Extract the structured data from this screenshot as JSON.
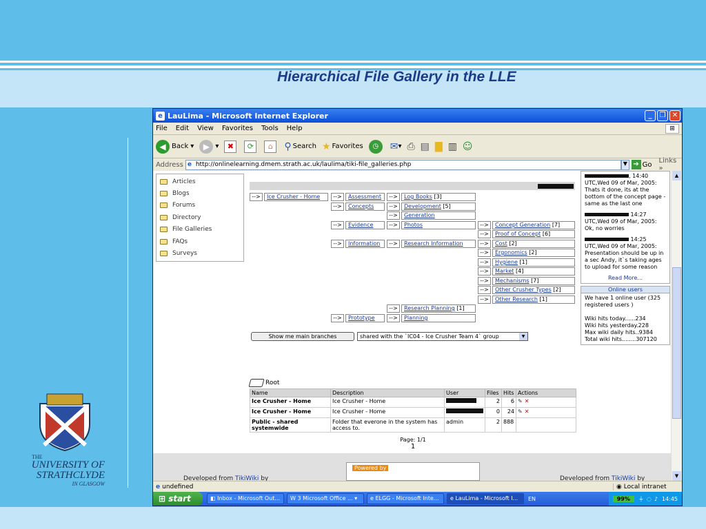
{
  "slide": {
    "title": "Hierarchical File Gallery in the LLE",
    "logo": {
      "the": "THE",
      "line1": "UNIVERSITY OF",
      "line2": "STRATHCLYDE",
      "line3": "IN GLASGOW"
    }
  },
  "window": {
    "title": "LauLima - Microsoft Internet Explorer",
    "menu": [
      "File",
      "Edit",
      "View",
      "Favorites",
      "Tools",
      "Help"
    ],
    "toolbar": {
      "back": "Back",
      "search": "Search",
      "favorites": "Favorites"
    },
    "address": {
      "label": "Address",
      "url": "http://onlinelearning.dmem.strath.ac.uk/laulima/tiki-file_galleries.php",
      "go": "Go",
      "links": "Links"
    }
  },
  "leftnav": [
    "Articles",
    "Blogs",
    "Forums",
    "Directory",
    "File Galleries",
    "FAQs",
    "Surveys"
  ],
  "tree": {
    "arrow": "-->",
    "root": "Ice Crusher - Home",
    "level2": [
      {
        "name": "Assessment"
      },
      {
        "name": "Concepts"
      },
      {
        "name": "Evidence"
      },
      {
        "name": "Information"
      },
      {
        "name": "Prototype"
      }
    ],
    "level3": [
      {
        "name": "Log Books",
        "count": "[3]"
      },
      {
        "name": "Development",
        "count": "[5]"
      },
      {
        "name": "Generation",
        "count": ""
      },
      {
        "name": "Photos",
        "count": ""
      },
      {
        "name": "Research Information",
        "count": ""
      },
      {
        "name": "Research Planning",
        "count": "[1]"
      },
      {
        "name": "Planning",
        "count": ""
      }
    ],
    "level4": [
      {
        "name": "Concept Generation",
        "count": "[7]"
      },
      {
        "name": "Proof of Concept",
        "count": "[6]"
      },
      {
        "name": "Cost",
        "count": "[2]"
      },
      {
        "name": "Ergonomics",
        "count": "[2]"
      },
      {
        "name": "Hygiene",
        "count": "[1]"
      },
      {
        "name": "Market",
        "count": "[4]"
      },
      {
        "name": "Mechanisms",
        "count": "[7]"
      },
      {
        "name": "Other Crusher Types",
        "count": "[2]"
      },
      {
        "name": "Other Research",
        "count": "[1]"
      }
    ]
  },
  "controls": {
    "show_button": "Show me main branches",
    "group_select": "shared with the `IC04 - Ice Crusher Team 4` group"
  },
  "gallery": {
    "root_label": "Root",
    "columns": [
      "Name",
      "Description",
      "User",
      "Files",
      "Hits",
      "Actions"
    ],
    "rows": [
      {
        "name": "Ice Crusher - Home",
        "description": "Ice Crusher - Home",
        "user": "",
        "files": "2",
        "hits": "6"
      },
      {
        "name": "Ice Crusher - Home",
        "description": "Ice Crusher - Home",
        "user": "",
        "files": "0",
        "hits": "24"
      },
      {
        "name": "Public - shared systemwide",
        "description": "Folder that everone in the system has access to.",
        "user": "admin",
        "files": "2",
        "hits": "888"
      }
    ],
    "page": "Page: 1/1",
    "page_number": "1"
  },
  "footer": {
    "developed": "Developed from",
    "tiki": "TikiWiki",
    "by": "by",
    "powered": "Powered by"
  },
  "rpanel": {
    "messages": [
      {
        "time": ", 14:40",
        "text": "UTC,Wed 09 of Mar, 2005: Thats it done, its at the bottom of the concept page - same as the last one"
      },
      {
        "time": " 14:27",
        "text": "UTC,Wed 09 of Mar, 2005: Ok, no worries"
      },
      {
        "time": " 14:25",
        "text": "UTC,Wed 09 of Mar, 2005: Presentation should be up in a sec Andy, it`s taking ages to upload for some reason"
      }
    ],
    "read_more": "Read More...",
    "online_title": "Online users",
    "online_text": "We have 1 online user (325 registered users )",
    "stats": [
      "Wiki hits today......234",
      "Wiki hits yesterday.228",
      "Max wiki daily hits..9384",
      "Total wiki hits........307120"
    ]
  },
  "statusbar": {
    "left": "undefined",
    "zone": "Local intranet"
  },
  "taskbar": {
    "start": "start",
    "tasks": [
      "Inbox - Microsoft Out...",
      "3 Microsoft Office ...",
      "ELGG - Microsoft Inte...",
      "LauLima - Microsoft I..."
    ],
    "lang": "EN",
    "battery": "99%",
    "clock": "14:45"
  }
}
